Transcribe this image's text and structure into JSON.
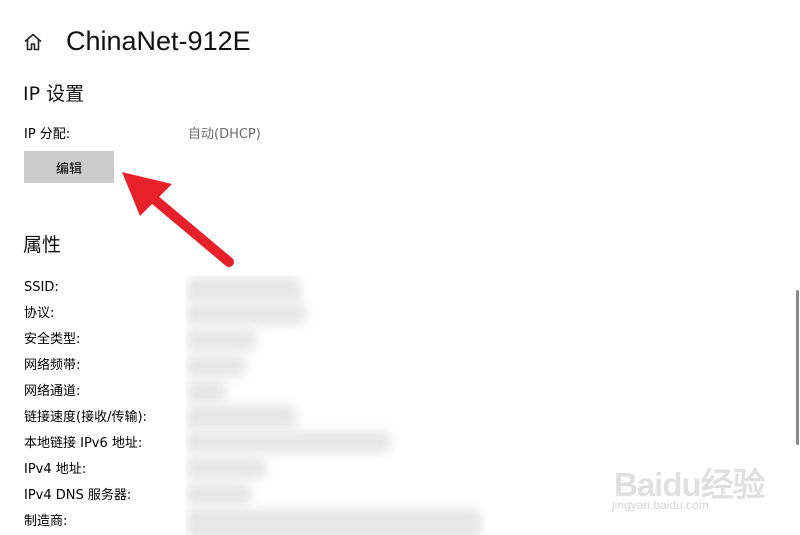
{
  "header": {
    "home_icon": "home-icon",
    "title": "ChinaNet-912E"
  },
  "ip_settings": {
    "section_title": "IP 设置",
    "assignment_label": "IP 分配:",
    "assignment_value": "自动(DHCP)",
    "edit_button_label": "编辑"
  },
  "properties": {
    "section_title": "属性",
    "labels": [
      "SSID:",
      "协议:",
      "安全类型:",
      "网络频带:",
      "网络通道:",
      "链接速度(接收/传输):",
      "本地链接 IPv6 地址:",
      "IPv4 地址:",
      "IPv4 DNS 服务器:",
      "制造商:"
    ]
  },
  "annotation": {
    "arrow_color": "#e8202a"
  },
  "watermark": {
    "brand": "Baidu经验",
    "url": "jingyan.baidu.com"
  },
  "colors": {
    "button_bg": "#cccccc",
    "secondary_text": "#6b6b6b"
  }
}
